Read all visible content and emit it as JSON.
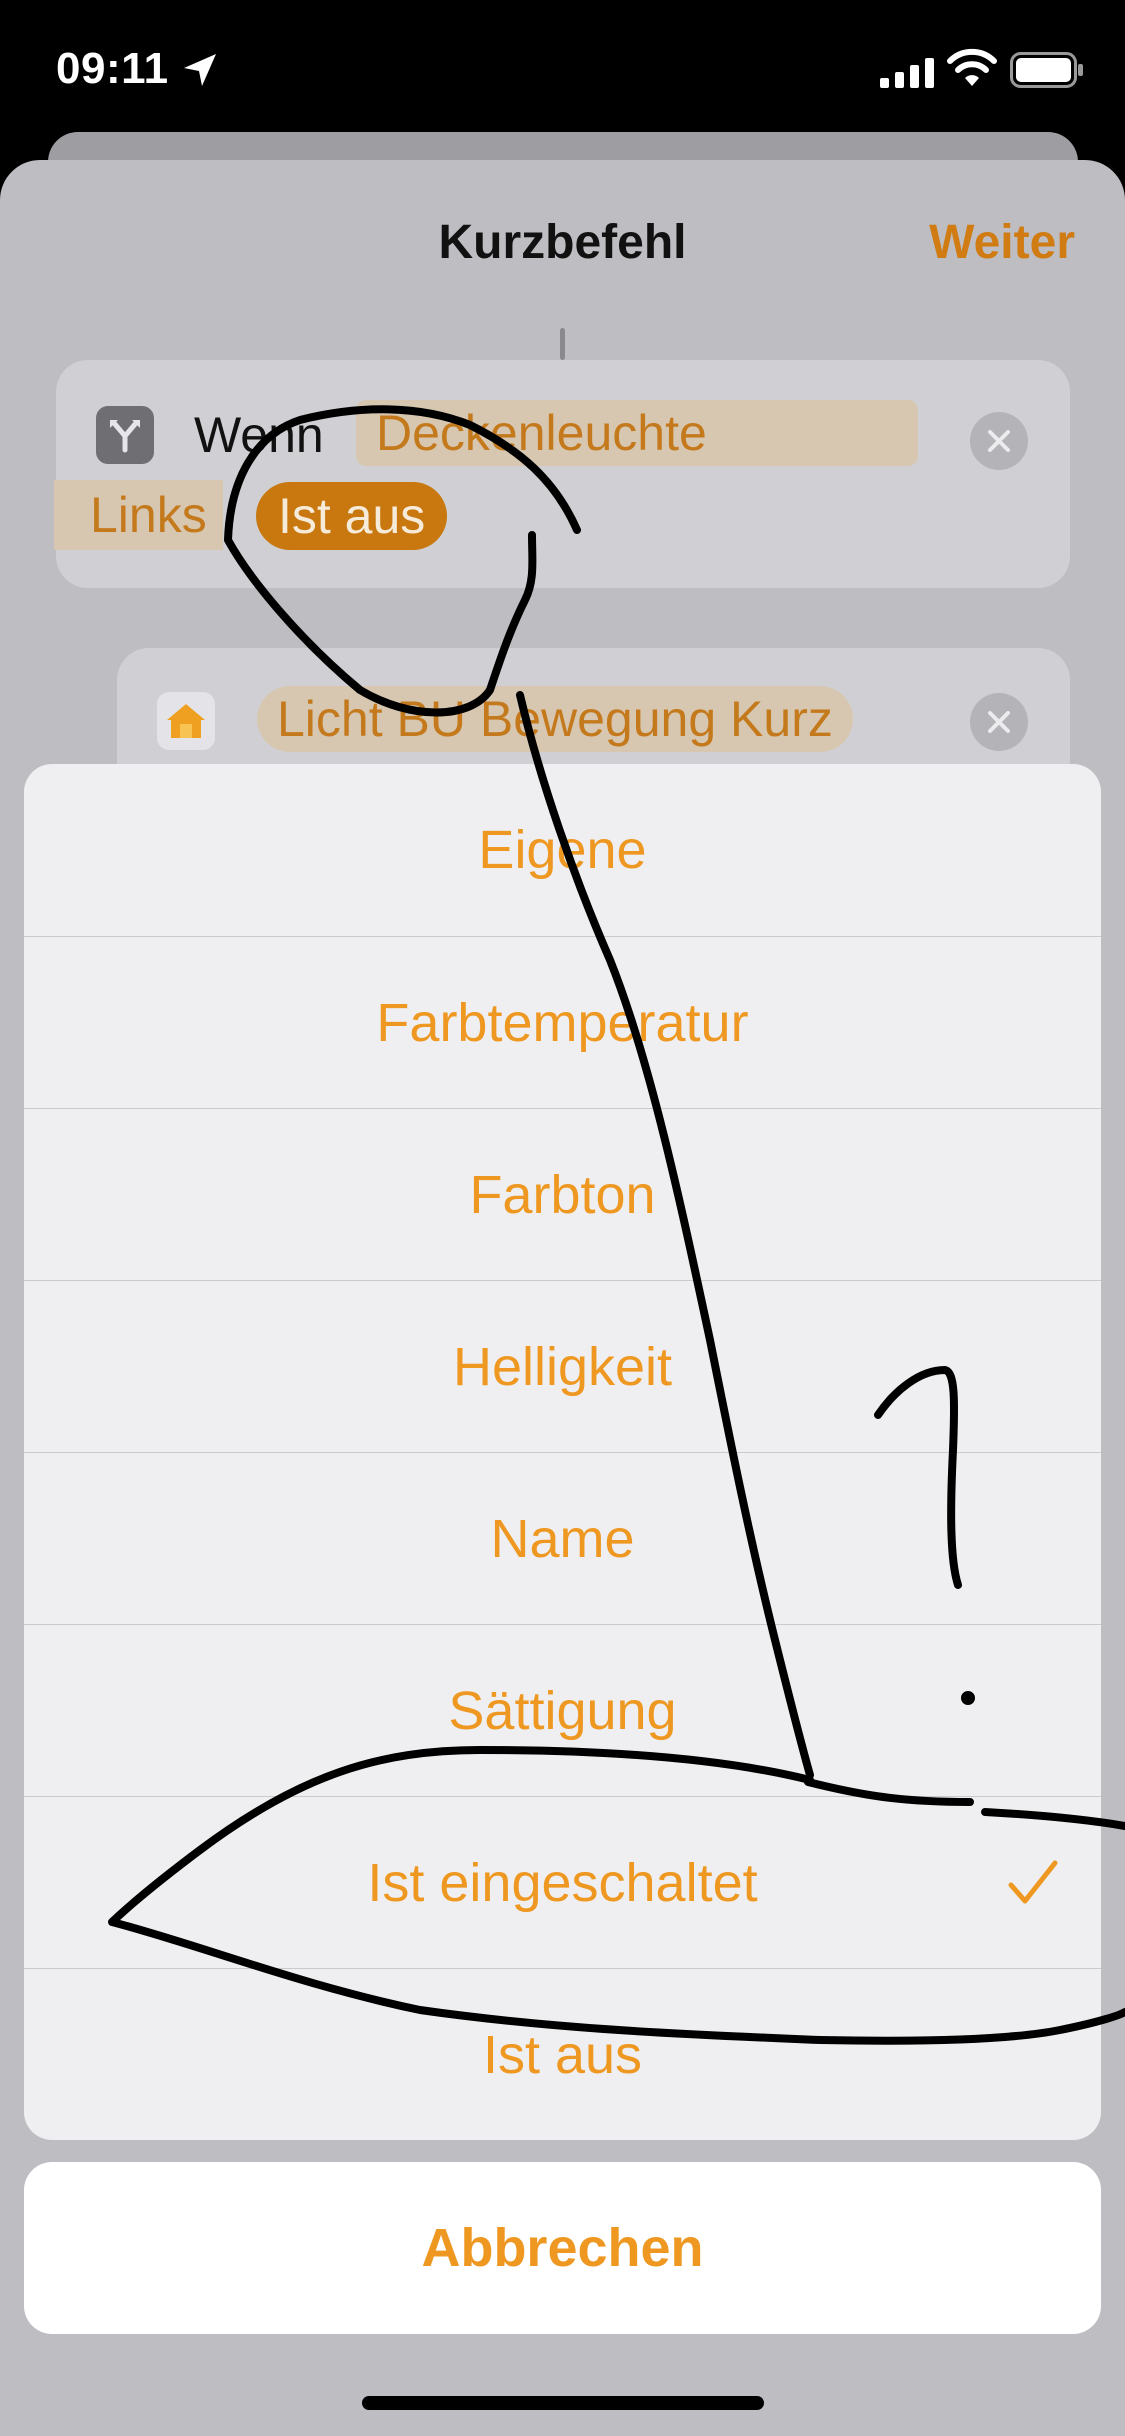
{
  "status_bar": {
    "time": "09:11",
    "icons": [
      "location-arrow-icon",
      "cellular-signal-icon",
      "wifi-icon",
      "battery-icon"
    ]
  },
  "header": {
    "title": "Kurzbefehl",
    "next_label": "Weiter"
  },
  "if_action": {
    "icon": "if-branch-icon",
    "label": "Wenn",
    "device_token": "Deckenleuchte",
    "device_token_continued": "Links",
    "condition_token": "Ist aus"
  },
  "home_action": {
    "icon": "home-icon",
    "scene_token": "Licht BU Bewegung Kurz"
  },
  "options_sheet": {
    "options": [
      {
        "label": "Eigene",
        "selected": false
      },
      {
        "label": "Farbtemperatur",
        "selected": false
      },
      {
        "label": "Farbton",
        "selected": false
      },
      {
        "label": "Helligkeit",
        "selected": false
      },
      {
        "label": "Name",
        "selected": false
      },
      {
        "label": "Sättigung",
        "selected": false
      },
      {
        "label": "Ist eingeschaltet",
        "selected": true
      },
      {
        "label": "Ist aus",
        "selected": false
      }
    ],
    "cancel_label": "Abbrechen"
  },
  "colors": {
    "accent": "#ee9821",
    "accent_dimmed": "#c47a1c",
    "sheet_background": "#efeff1",
    "overlay_background": "#bdbdc2"
  }
}
